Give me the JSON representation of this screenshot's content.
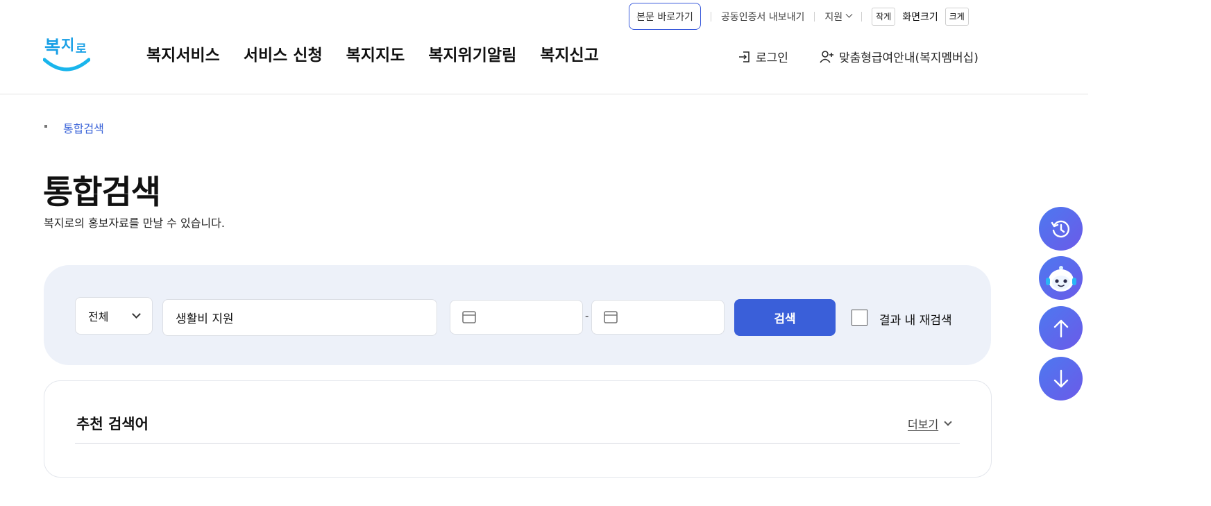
{
  "util": {
    "skip_link": "본문 바로가기",
    "cert_export": "공동인증서 내보내기",
    "support": "지원",
    "font_small": "작게",
    "font_label": "화면크기",
    "font_large": "크게"
  },
  "header": {
    "logo_text": "복지로",
    "nav": [
      "복지서비스",
      "서비스 신청",
      "복지지도",
      "복지위기알림",
      "복지신고"
    ],
    "login": "로그인",
    "membership": "맞춤형급여안내(복지멤버십)"
  },
  "breadcrumb": "통합검색",
  "page": {
    "title": "통합검색",
    "description": "복지로의 홍보자료를 만날 수 있습니다."
  },
  "search": {
    "category": "전체",
    "keyword": "생활비 지원",
    "date_from": "",
    "date_to": "",
    "date_separator": "-",
    "button": "검색",
    "research_label": "결과 내 재검색",
    "research_checked": false
  },
  "recommend": {
    "title": "추천 검색어",
    "more": "더보기"
  },
  "floating": [
    "recent-icon",
    "chatbot-icon",
    "arrow-up-icon",
    "arrow-down-icon"
  ],
  "colors": {
    "primary": "#3a5fd9",
    "panel": "#edf1f9",
    "fab": "#5a6cec"
  }
}
